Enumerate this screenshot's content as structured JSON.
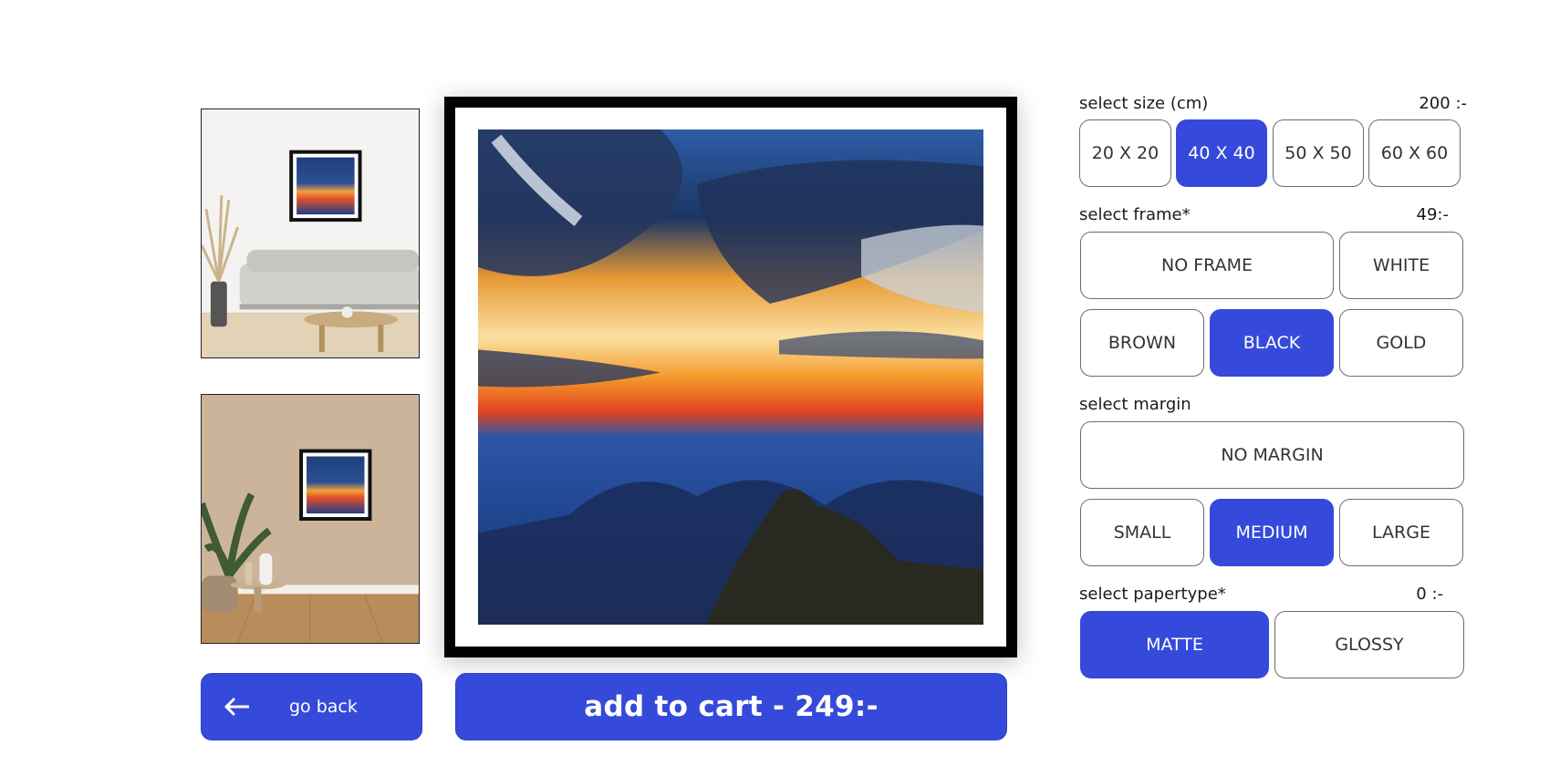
{
  "thumbnails": [
    {
      "name": "room-living-white",
      "description_icon": "room-preview-icon"
    },
    {
      "name": "room-beige-plant",
      "description_icon": "room-preview-icon"
    }
  ],
  "actions": {
    "back_label": "go back",
    "back_icon": "arrow-left-icon",
    "add_to_cart_label": "add to cart - 249:-"
  },
  "size": {
    "label": "select size (cm)",
    "price": "200 :-",
    "options": [
      "20 X 20",
      "40 X 40",
      "50 X 50",
      "60 X 60"
    ],
    "selected": "40 X 40"
  },
  "frame": {
    "label": "select frame*",
    "price": "49:-",
    "options": [
      "NO FRAME",
      "WHITE",
      "BROWN",
      "BLACK",
      "GOLD"
    ],
    "selected": "BLACK"
  },
  "margin": {
    "label": "select margin",
    "options": [
      "NO MARGIN",
      "SMALL",
      "MEDIUM",
      "LARGE"
    ],
    "selected": "MEDIUM"
  },
  "papertype": {
    "label": "select papertype*",
    "price": "0 :-",
    "options": [
      "MATTE",
      "GLOSSY"
    ],
    "selected": "MATTE"
  },
  "colors": {
    "accent": "#354ada",
    "frame_black": "#000000",
    "border_gray": "#6c6c6c"
  }
}
